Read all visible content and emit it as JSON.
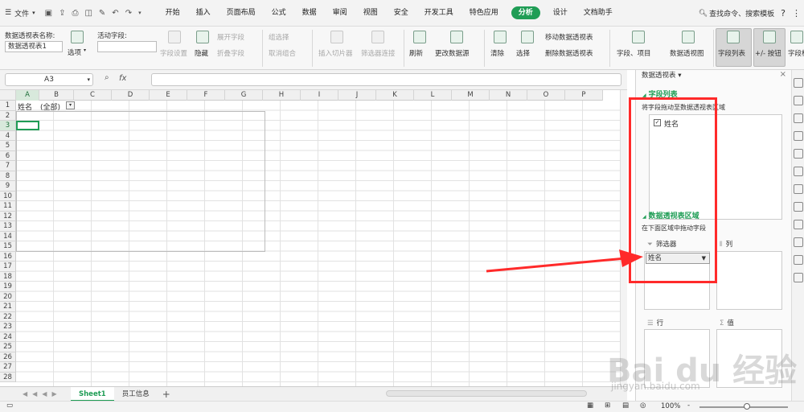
{
  "menubar": {
    "file_label": "文件",
    "tabs": [
      "开始",
      "插入",
      "页面布局",
      "公式",
      "数据",
      "审阅",
      "视图",
      "安全",
      "开发工具",
      "特色应用",
      "分析",
      "设计",
      "文档助手"
    ],
    "search_label": "查找命令、搜索模板",
    "help": "?",
    "more": "⋮"
  },
  "ribbon": {
    "pivot_name_label": "数据透视表名称:",
    "pivot_name_value": "数据透视表1",
    "options": "选项",
    "active_field_label": "活动字段:",
    "field_settings": "字段设置",
    "hide": "隐藏",
    "expand_field": "展开字段",
    "collapse_field": "折叠字段",
    "group_select": "组选择",
    "ungroup": "取消组合",
    "insert_slicer": "插入切片器",
    "filter_connection": "筛选器连接",
    "refresh": "刷新",
    "change_source": "更改数据源",
    "clear": "清除",
    "select": "选择",
    "move_pivot": "移动数据透视表",
    "delete_pivot": "删除数据透视表",
    "fields_items": "字段、项目",
    "pivot_chart": "数据透视图",
    "field_list": "字段列表",
    "plus_minus": "+/- 按钮",
    "headers_partial": "字段标"
  },
  "formula_bar": {
    "cell_ref": "A3",
    "fx": "fx"
  },
  "sheet": {
    "columns": [
      "A",
      "B",
      "C",
      "D",
      "E",
      "F",
      "G",
      "H",
      "I",
      "J",
      "K",
      "L",
      "M",
      "N",
      "O",
      "P"
    ],
    "rows": [
      "1",
      "2",
      "3",
      "4",
      "5",
      "6",
      "7",
      "8",
      "9",
      "10",
      "11",
      "12",
      "13",
      "14",
      "15",
      "16",
      "17",
      "18",
      "19",
      "20",
      "21",
      "22",
      "23",
      "24",
      "25",
      "26",
      "27",
      "28"
    ],
    "a1": "姓名",
    "b1": "(全部)"
  },
  "sheet_tabs": {
    "tabs": [
      "Sheet1",
      "员工信息"
    ],
    "add": "+"
  },
  "status": {
    "zoom": "100%",
    "minus": "-"
  },
  "panel": {
    "title": "数据透视表",
    "section_fields": "字段列表",
    "hint_fields": "将字段拖动至数据透视表区域",
    "field_name": "姓名",
    "section_areas": "数据透视表区域",
    "hint_areas": "在下面区域中拖动字段",
    "filter_label": "筛选器",
    "col_label": "列",
    "row_label": "行",
    "value_label": "值",
    "filter_chip": "姓名"
  },
  "watermark": {
    "brand": "Bai du 经验",
    "url": "jingyan.baidu.com"
  },
  "colors": {
    "accent": "#1f9d55",
    "annotation_red": "#ff2a2a"
  }
}
